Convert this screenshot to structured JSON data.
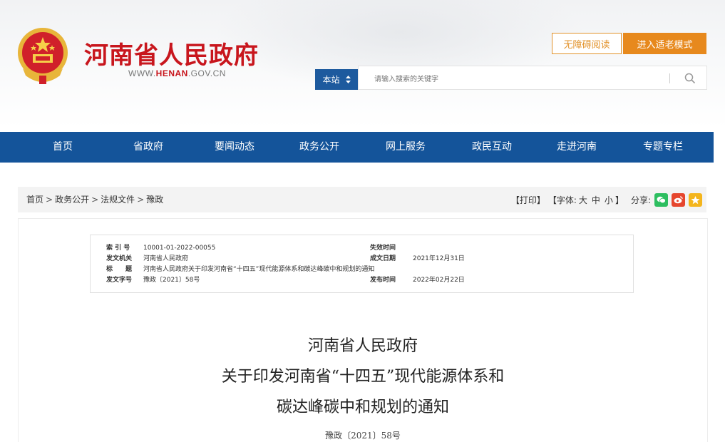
{
  "header": {
    "site_title": "河南省人民政府",
    "url_prefix": "WWW.",
    "url_brand": "HENAN",
    "url_suffix": ".GOV.CN",
    "accessibility_label": "无障碍阅读",
    "elder_mode_label": "进入适老模式",
    "search": {
      "scope": "本站",
      "placeholder": "请输入搜索的关键字"
    }
  },
  "nav": {
    "items": [
      "首页",
      "省政府",
      "要闻动态",
      "政务公开",
      "网上服务",
      "政民互动",
      "走进河南",
      "专题专栏"
    ]
  },
  "breadcrumb": {
    "items": [
      "首页",
      "政务公开",
      "法规文件",
      "豫政"
    ],
    "separator": ">"
  },
  "tools": {
    "print": "【打印】",
    "font_prefix": "【字体:",
    "font_large": "大",
    "font_medium": "中",
    "font_small": "小",
    "font_suffix": "】",
    "share_label": "分享:",
    "share_icons": [
      "wechat-icon",
      "weibo-icon",
      "qzone-icon"
    ],
    "share_colors": [
      "#2dbe60",
      "#e6462d",
      "#f4b51c"
    ]
  },
  "meta": {
    "index_key": "索 引 号",
    "index_value": "10001-01-2022-00055",
    "issuer_key": "发文机关",
    "issuer_value": "河南省人民政府",
    "subject_key": "标　　题",
    "subject_value": "河南省人民政府关于印发河南省“十四五”现代能源体系和碳达峰碳中和规划的通知",
    "docno_key": "发文字号",
    "docno_value": "豫政〔2021〕58号",
    "expiry_key": "失效时间",
    "expiry_value": "",
    "created_key": "成文日期",
    "created_value": "2021年12月31日",
    "published_key": "发布时间",
    "published_value": "2022年02月22日"
  },
  "document": {
    "title_line1": "河南省人民政府",
    "title_line2": "关于印发河南省“十四五”现代能源体系和",
    "title_line3": "碳达峰碳中和规划的通知",
    "doc_number": "豫政〔2021〕58号"
  },
  "colors": {
    "brand_red": "#c8161d",
    "nav_blue": "#14549a",
    "accent_orange": "#e7891d"
  }
}
